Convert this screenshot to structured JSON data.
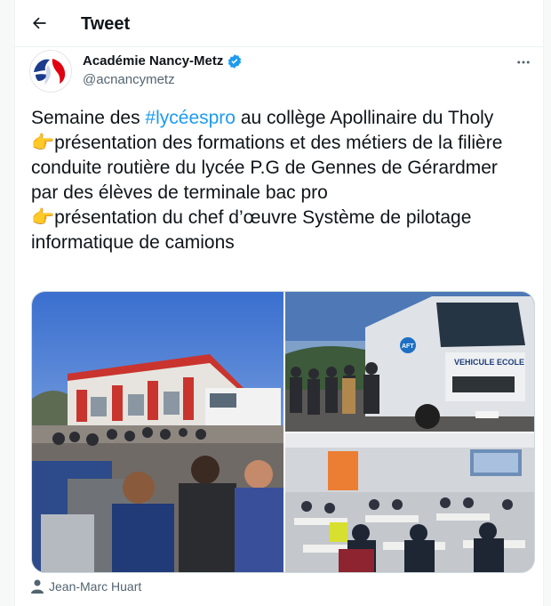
{
  "header": {
    "title": "Tweet",
    "back_icon": "arrow-left-icon"
  },
  "author": {
    "display_name": "Académie Nancy-Metz",
    "handle": "@acnancymetz",
    "verified_color": "#1d9bf0",
    "more_icon": "more-horizontal-icon"
  },
  "tweet": {
    "line1_pre": "Semaine des ",
    "hashtag": "#lycéespro",
    "line1_post": " au collège Apollinaire du Tholy",
    "para2": "👉présentation des formations et des métiers de la filière conduite routière du lycée P.G de Gennes de Gérardmer par des élèves de terminale bac pro",
    "para3": "👉présentation du chef d’œuvre Système de pilotage informatique de camions"
  },
  "media": {
    "truck_label": "VEHICULE ECOLE",
    "truck_badge": "AFT"
  },
  "credit": {
    "icon": "user-icon",
    "name": "Jean-Marc Huart"
  },
  "colors": {
    "accent": "#1d9bf0",
    "text": "#0f1419",
    "secondary": "#536471"
  }
}
